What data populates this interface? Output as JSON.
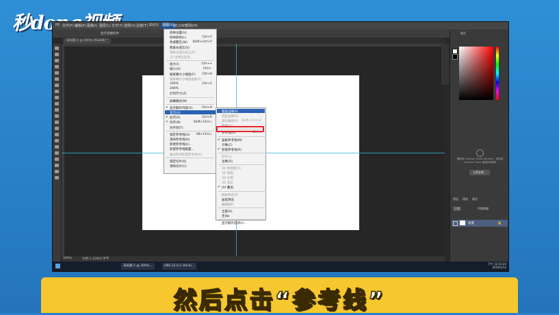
{
  "branding": {
    "logo_text": "秒dong视频"
  },
  "caption": {
    "text": "然后点击“参考线”"
  },
  "menubar": {
    "items": [
      "PS",
      "文件(F)",
      "编辑(E)",
      "图像(I)",
      "图层(L)",
      "文字(Y)",
      "选择(S)",
      "滤镜(T)",
      "3D(D)",
      "视图(V)",
      "窗口(W)",
      "帮助(H)"
    ],
    "active": "视图(V)"
  },
  "options_bar": {
    "mode_label": "显示变换控件",
    "workspace": "基本功能"
  },
  "document": {
    "tab_label": "未标题-1 @ 300% (RGB/8) *",
    "status_left": "300%",
    "status_doc": "文档:1.22M/0 字节"
  },
  "view_menu": {
    "items": [
      {
        "label": "校样设置(U)",
        "shortcut": "",
        "disabled": false,
        "checked": false
      },
      {
        "label": "校样颜色(L)",
        "shortcut": "Ctrl+Y",
        "disabled": false,
        "checked": false
      },
      {
        "label": "色域警告(W)",
        "shortcut": "Shift+Ctrl+Y",
        "disabled": false,
        "checked": false
      },
      {
        "label": "像素长宽比(S)",
        "shortcut": "",
        "disabled": false,
        "checked": false
      },
      {
        "label": "像素长宽比校正(P)",
        "shortcut": "",
        "disabled": true,
        "checked": false
      },
      {
        "label": "32 位预览选项...",
        "shortcut": "",
        "disabled": true,
        "checked": false
      },
      {
        "label": "放大(I)",
        "shortcut": "Ctrl++",
        "disabled": false,
        "checked": false
      },
      {
        "label": "缩小(O)",
        "shortcut": "Ctrl+-",
        "disabled": false,
        "checked": false
      },
      {
        "label": "按屏幕大小缩放(F)",
        "shortcut": "Ctrl+0",
        "disabled": false,
        "checked": false
      },
      {
        "label": "按屏幕大小缩放画板(F)",
        "shortcut": "",
        "disabled": true,
        "checked": false
      },
      {
        "label": "100%",
        "shortcut": "Ctrl+1",
        "disabled": false,
        "checked": false
      },
      {
        "label": "200%",
        "shortcut": "",
        "disabled": false,
        "checked": false
      },
      {
        "label": "打印尺寸(Z)",
        "shortcut": "",
        "disabled": false,
        "checked": false
      },
      {
        "label": "屏幕模式(M)",
        "shortcut": "",
        "disabled": false,
        "checked": false
      },
      {
        "label": "显示额外内容(X)",
        "shortcut": "Ctrl+H",
        "disabled": false,
        "checked": true
      },
      {
        "label": "显示(H)",
        "shortcut": "",
        "disabled": false,
        "checked": false,
        "selected": true
      },
      {
        "label": "标尺(R)",
        "shortcut": "Ctrl+R",
        "disabled": false,
        "checked": true
      },
      {
        "label": "对齐(N)",
        "shortcut": "Shift+Ctrl+;",
        "disabled": false,
        "checked": true
      },
      {
        "label": "对齐到(T)",
        "shortcut": "",
        "disabled": false,
        "checked": false
      },
      {
        "label": "锁定参考线(G)",
        "shortcut": "Alt+Ctrl+;",
        "disabled": false,
        "checked": false
      },
      {
        "label": "清除参考线(D)",
        "shortcut": "",
        "disabled": false,
        "checked": false
      },
      {
        "label": "新建参考线(E)...",
        "shortcut": "",
        "disabled": false,
        "checked": false
      },
      {
        "label": "新建参考线版面...",
        "shortcut": "",
        "disabled": false,
        "checked": false
      },
      {
        "label": "通过形状新建参考线(A)",
        "shortcut": "",
        "disabled": true,
        "checked": false
      },
      {
        "label": "锁定切片(K)",
        "shortcut": "",
        "disabled": false,
        "checked": false
      },
      {
        "label": "清除切片(C)",
        "shortcut": "",
        "disabled": false,
        "checked": false
      }
    ]
  },
  "show_submenu": {
    "items": [
      {
        "label": "图层边缘(E)",
        "shortcut": "",
        "checked": false,
        "disabled": false,
        "selected": true
      },
      {
        "label": "选区边缘(S)",
        "shortcut": "",
        "checked": false,
        "disabled": true
      },
      {
        "label": "目标路径(P)",
        "shortcut": "Shift+Ctrl+H",
        "checked": false,
        "disabled": true
      },
      {
        "label": "网格(G)",
        "shortcut": "",
        "checked": false,
        "disabled": true
      },
      {
        "label": "参考线(U)",
        "shortcut": "Ctrl+;",
        "checked": true,
        "disabled": false,
        "highlighted": true
      },
      {
        "label": "画板参考线(M)",
        "shortcut": "",
        "checked": true,
        "disabled": false
      },
      {
        "label": "计数(C)",
        "shortcut": "",
        "checked": false,
        "disabled": false
      },
      {
        "label": "智能参考线(R)",
        "shortcut": "",
        "checked": true,
        "disabled": false
      },
      {
        "label": "切片(L)",
        "shortcut": "",
        "checked": false,
        "disabled": true
      },
      {
        "label": "注释(O)",
        "shortcut": "",
        "checked": false,
        "disabled": false
      },
      {
        "label": "3D 副视图(V)",
        "shortcut": "",
        "checked": false,
        "disabled": true
      },
      {
        "label": "3D 地面",
        "shortcut": "",
        "checked": false,
        "disabled": true
      },
      {
        "label": "3D 光源",
        "shortcut": "",
        "checked": false,
        "disabled": true
      },
      {
        "label": "3D 选区",
        "shortcut": "",
        "checked": false,
        "disabled": true
      },
      {
        "label": "UV 叠加",
        "shortcut": "",
        "checked": true,
        "disabled": false
      },
      {
        "label": "网格预览(P)",
        "shortcut": "",
        "checked": false,
        "disabled": true
      },
      {
        "label": "画笔预览",
        "shortcut": "",
        "checked": false,
        "disabled": false
      },
      {
        "label": "编辑图钉",
        "shortcut": "",
        "checked": false,
        "disabled": true
      },
      {
        "label": "全部(A)",
        "shortcut": "",
        "checked": false,
        "disabled": false
      },
      {
        "label": "无(N)",
        "shortcut": "",
        "checked": false,
        "disabled": false
      },
      {
        "label": "显示额外选项(I)...",
        "shortcut": "",
        "checked": false,
        "disabled": false
      }
    ]
  },
  "panels": {
    "color_tab": "颜色",
    "library_text": "要使用 Creative Cloud Libraries，请安装 Creative Cloud 桌面应用程序",
    "library_button": "立即安装...",
    "layers_tabs": [
      "图层",
      "通道",
      "路径"
    ],
    "layer_kind": "正常",
    "opacity": "不透明度:",
    "layer_name": "背景"
  },
  "taskbar": {
    "ps_button": "未标题-1 @ 300%...",
    "obs_button": "OBS 22.0.2 (64-bi...",
    "time": "下午 12:14:24",
    "date": "2019/1/12"
  },
  "colors": {
    "frame": "#2474bb",
    "caption_bar": "#f6c72e",
    "menu_select": "#2a62b5",
    "highlight_box": "#e8232a",
    "guide": "#37b7d6"
  }
}
